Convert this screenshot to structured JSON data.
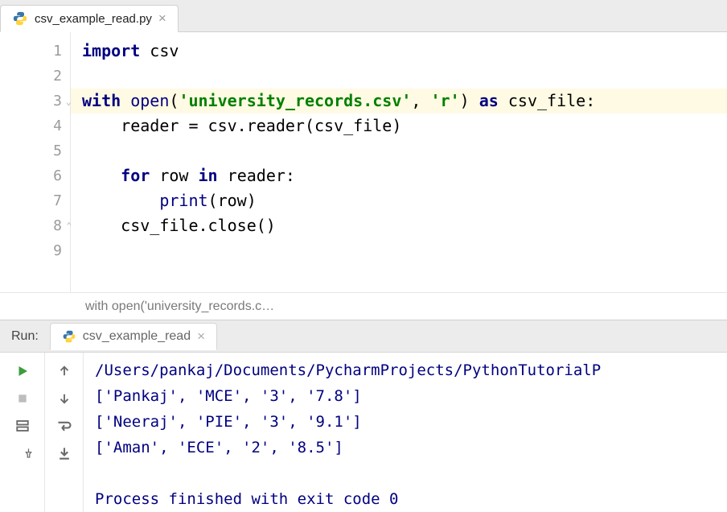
{
  "editor_tab": {
    "filename": "csv_example_read.py"
  },
  "code_lines": [
    {
      "n": "1",
      "t": "import",
      "html": "<span class='kw'>import</span> csv"
    },
    {
      "n": "2",
      "t": "",
      "html": ""
    },
    {
      "n": "3",
      "t": "with",
      "hl": true,
      "fold": true,
      "html": "<span class='kw'>with</span> <span class='builtin'>open</span>(<span class='str'>'university_records.csv'</span>, <span class='str'>'r'</span>) <span class='kw'>as</span> csv_file:"
    },
    {
      "n": "4",
      "t": "",
      "html": "    reader = csv.reader(csv_file)"
    },
    {
      "n": "5",
      "t": "",
      "html": ""
    },
    {
      "n": "6",
      "t": "",
      "html": "    <span class='kw'>for</span> row <span class='kw'>in</span> reader:"
    },
    {
      "n": "7",
      "t": "",
      "html": "        <span class='builtin'>print</span>(row)"
    },
    {
      "n": "8",
      "t": "",
      "fold_end": true,
      "html": "    csv_file.close()"
    },
    {
      "n": "9",
      "t": "",
      "html": ""
    }
  ],
  "breadcrumb": "with open('university_records.c…",
  "run": {
    "label": "Run:",
    "tab_name": "csv_example_read",
    "output": [
      "/Users/pankaj/Documents/PycharmProjects/PythonTutorialP",
      "['Pankaj', 'MCE', '3', '7.8']",
      "['Neeraj', 'PIE', '3', '9.1']",
      "['Aman', 'ECE', '2', '8.5']",
      "",
      "Process finished with exit code 0"
    ]
  },
  "icons": {
    "close": "×",
    "play": "▶",
    "stop": "■",
    "layout": "▤",
    "pin": "⚲",
    "up": "↑",
    "down": "↓",
    "wrap": "↩",
    "scroll": "⤓"
  }
}
